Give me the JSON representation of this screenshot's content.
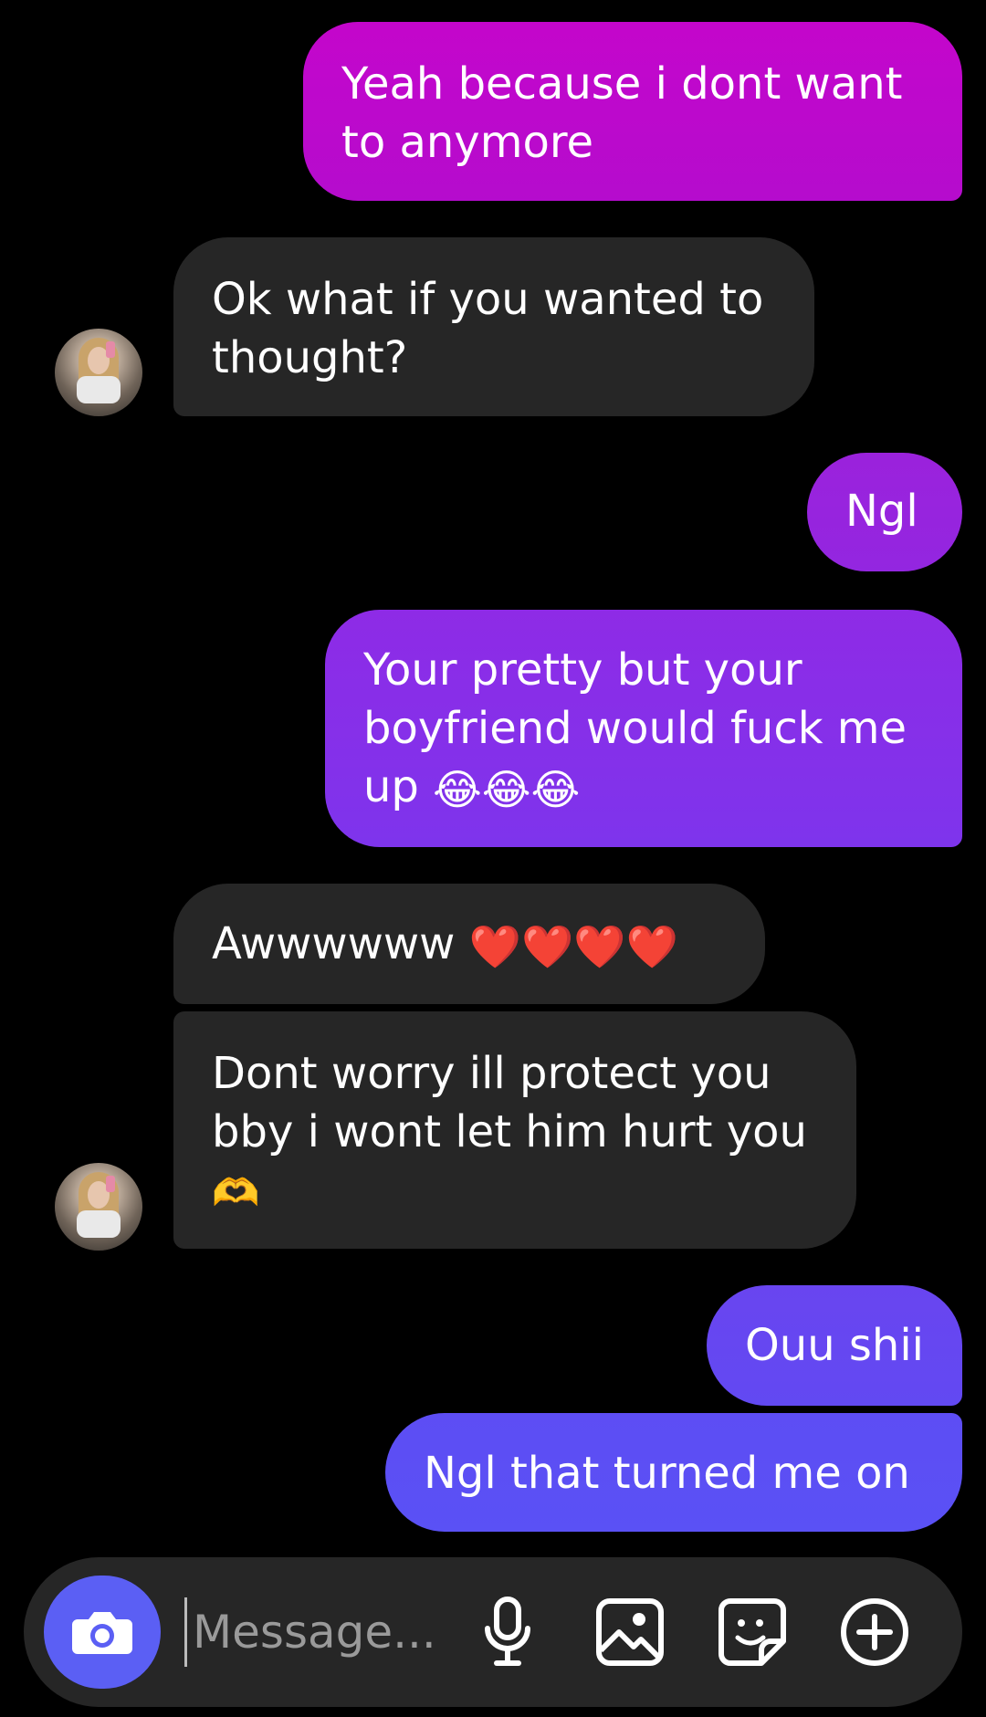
{
  "messages": [
    {
      "text": "Yeah because i dont want to anymore",
      "direction": "outgoing"
    },
    {
      "text": "Ok what if you wanted to thought?",
      "direction": "incoming"
    },
    {
      "text": "Ngl",
      "direction": "outgoing"
    },
    {
      "text": "Your pretty but your boyfriend would fuck me up",
      "emoji": "😂😂😂",
      "direction": "outgoing"
    },
    {
      "text": "Awwwwww",
      "emoji": "❤️❤️❤️❤️",
      "direction": "incoming"
    },
    {
      "text": "Dont worry ill protect you bby i wont let him hurt you",
      "emoji": "🫶",
      "direction": "incoming"
    },
    {
      "text": "Ouu shii",
      "direction": "outgoing"
    },
    {
      "text": "Ngl that turned me on",
      "direction": "outgoing"
    }
  ],
  "composer": {
    "placeholder": "Message...",
    "icons": [
      "camera-icon",
      "microphone-icon",
      "gallery-icon",
      "sticker-icon",
      "plus-icon"
    ]
  },
  "colors": {
    "background": "#000000",
    "incoming_bubble": "#262626",
    "outgoing_top": "#c00ac8",
    "outgoing_mid": "#8a2ce8",
    "outgoing_bottom": "#5b50f5",
    "camera_button": "#5b5ff4"
  }
}
